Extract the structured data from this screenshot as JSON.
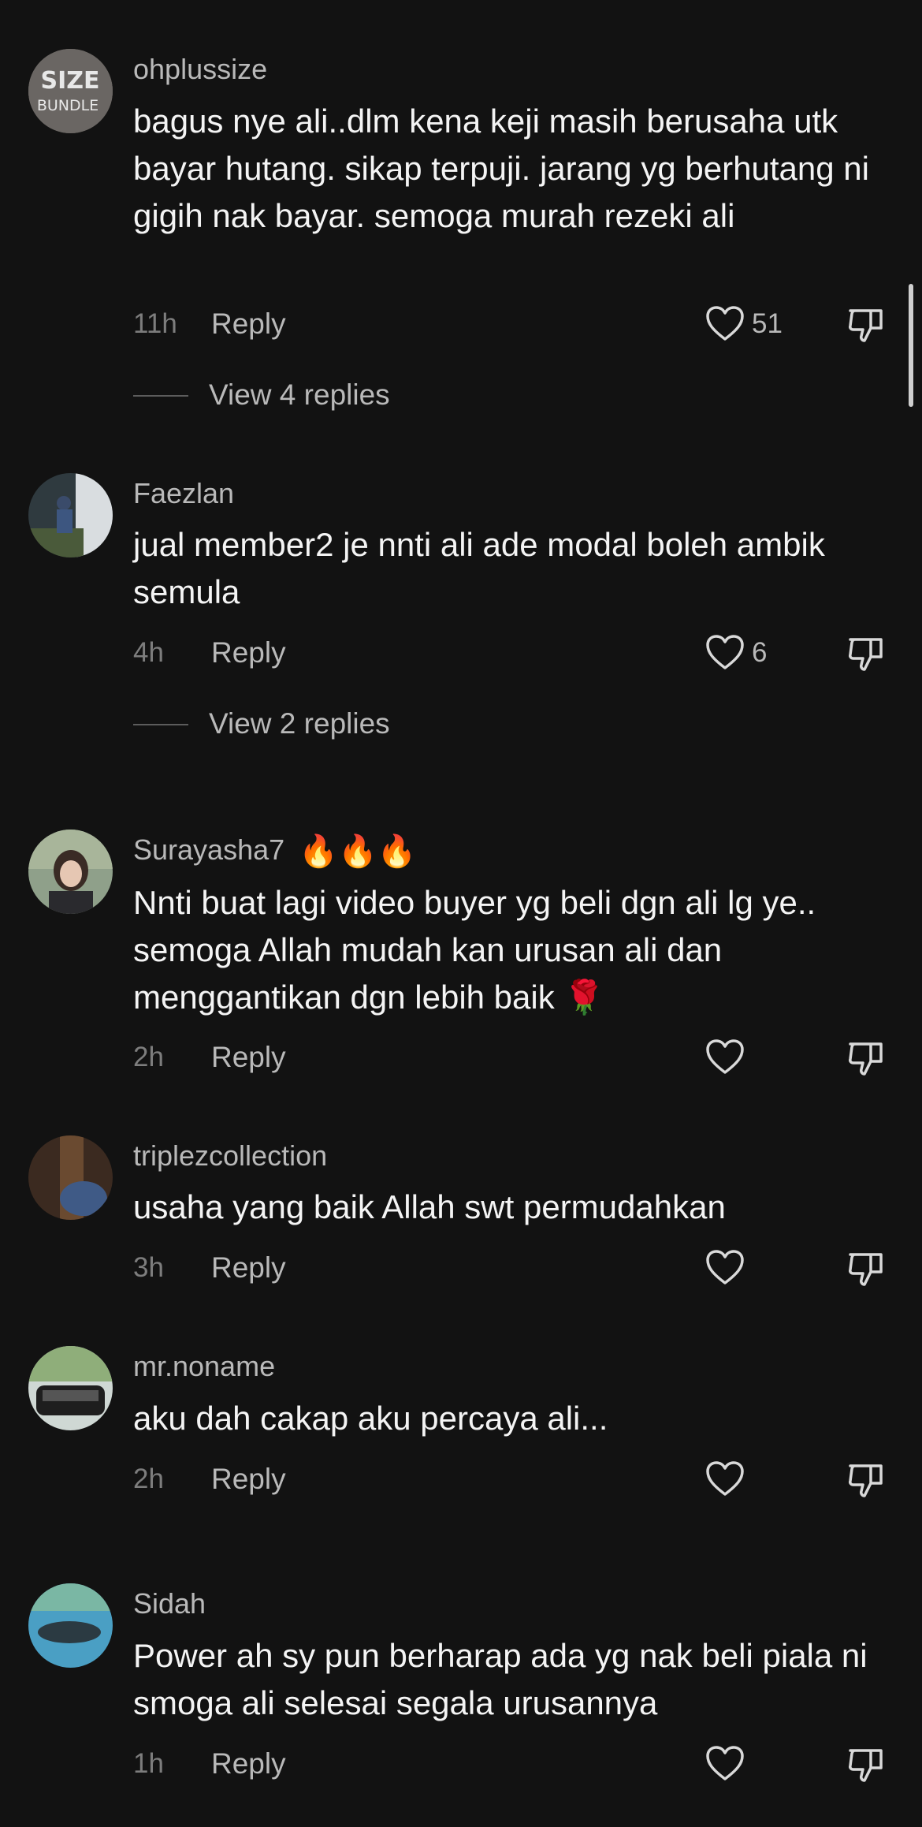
{
  "comments": [
    {
      "username": "ohplussize",
      "text": "bagus nye ali..dlm kena keji masih berusaha utk bayar hutang. sikap terpuji. jarang yg berhutang ni gigih nak bayar. semoga murah rezeki ali",
      "time": "11h",
      "reply_label": "Reply",
      "likes": "51",
      "view_replies": "View 4 replies",
      "avatar_text": "SIZE BUNDLE"
    },
    {
      "username": "Faezlan",
      "text": "jual member2 je nnti ali ade modal boleh ambik semula",
      "time": "4h",
      "reply_label": "Reply",
      "likes": "6",
      "view_replies": "View 2 replies"
    },
    {
      "username": "Surayasha7",
      "username_emojis": "🔥🔥🔥",
      "text": "Nnti buat lagi video buyer yg beli dgn ali lg ye.. semoga Allah mudah kan urusan ali dan menggantikan dgn lebih baik 🌹",
      "time": "2h",
      "reply_label": "Reply"
    },
    {
      "username": "triplezcollection",
      "text": "usaha yang baik Allah swt permudahkan",
      "time": "3h",
      "reply_label": "Reply"
    },
    {
      "username": "mr.noname",
      "text": "aku dah cakap aku percaya ali...",
      "time": "2h",
      "reply_label": "Reply"
    },
    {
      "username": "Sidah",
      "text": "Power ah sy pun berharap ada yg nak beli piala ni smoga ali selesai segala urusannya",
      "time": "1h",
      "reply_label": "Reply"
    }
  ],
  "icons": {
    "like": "heart-outline-icon",
    "dislike": "thumbs-down-outline-icon"
  },
  "colors": {
    "background": "#121212",
    "username": "#b9b9b9",
    "text": "#f4f4f4",
    "timestamp": "#7d7d7d"
  }
}
